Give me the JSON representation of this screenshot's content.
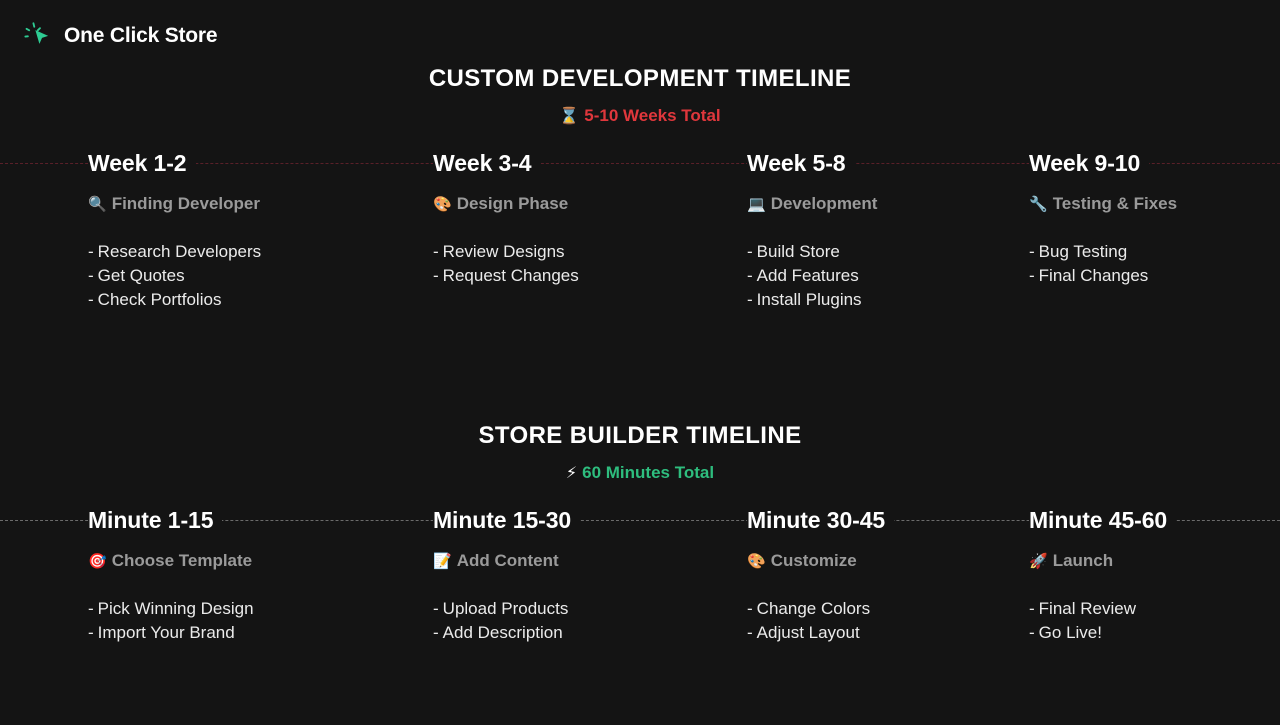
{
  "brand": {
    "name": "One Click Store",
    "logo_icon": "cursor-click-icon",
    "logo_color": "#2ecc93"
  },
  "colors": {
    "background": "#141414",
    "heading": "#ffffff",
    "sub_label": "#9a9a9a",
    "body_text": "#ebebeb",
    "accent_red": "#e0373c",
    "accent_green": "#2ebd7e",
    "rule_red": "#5a2029",
    "rule_gray": "#6b6b6b"
  },
  "sections": [
    {
      "id": "custom",
      "title": "CUSTOM DEVELOPMENT TIMELINE",
      "subtitle_emoji": "⌛",
      "subtitle_emoji_name": "hourglass-icon",
      "subtitle_text": "5-10 Weeks Total",
      "subtitle_color": "#e0373c",
      "rule_style": "red",
      "columns": [
        {
          "heading": "Week 1-2",
          "emoji": "🔍",
          "emoji_name": "magnifying-glass-icon",
          "sub_label": "Finding Developer",
          "items": [
            "Research Developers",
            "Get Quotes",
            "Check Portfolios"
          ]
        },
        {
          "heading": "Week 3-4",
          "emoji": "🎨",
          "emoji_name": "palette-icon",
          "sub_label": "Design Phase",
          "items": [
            "Review Designs",
            "Request Changes"
          ]
        },
        {
          "heading": "Week 5-8",
          "emoji": "💻",
          "emoji_name": "laptop-icon",
          "sub_label": "Development",
          "items": [
            "Build Store",
            "Add Features",
            "Install Plugins"
          ]
        },
        {
          "heading": "Week 9-10",
          "emoji": "🔧",
          "emoji_name": "wrench-icon",
          "sub_label": "Testing & Fixes",
          "items": [
            "Bug Testing",
            "Final Changes"
          ]
        }
      ]
    },
    {
      "id": "builder",
      "title": "STORE BUILDER TIMELINE",
      "subtitle_emoji": "⚡",
      "subtitle_emoji_name": "lightning-bolt-icon",
      "subtitle_text": "60 Minutes Total",
      "subtitle_color": "#2ebd7e",
      "rule_style": "gray",
      "columns": [
        {
          "heading": "Minute 1-15",
          "emoji": "🎯",
          "emoji_name": "bullseye-icon",
          "sub_label": "Choose Template",
          "items": [
            "Pick Winning Design",
            "Import Your Brand"
          ]
        },
        {
          "heading": "Minute 15-30",
          "emoji": "📝",
          "emoji_name": "memo-icon",
          "sub_label": "Add Content",
          "items": [
            "Upload Products",
            "Add Description"
          ]
        },
        {
          "heading": "Minute 30-45",
          "emoji": "🎨",
          "emoji_name": "palette-icon",
          "sub_label": "Customize",
          "items": [
            "Change Colors",
            "Adjust Layout"
          ]
        },
        {
          "heading": "Minute 45-60",
          "emoji": "🚀",
          "emoji_name": "rocket-icon",
          "sub_label": "Launch",
          "items": [
            "Final Review",
            "Go Live!"
          ]
        }
      ]
    }
  ]
}
